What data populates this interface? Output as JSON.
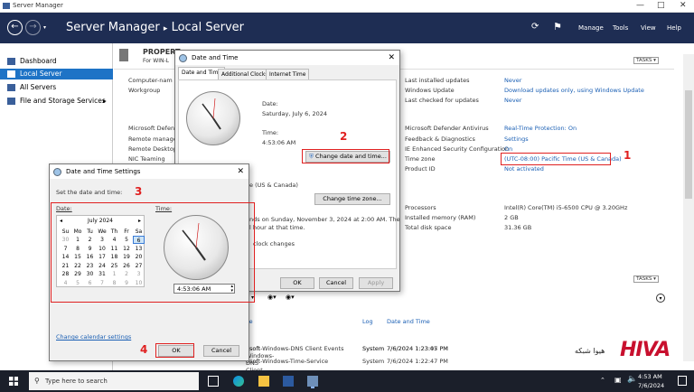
{
  "window": {
    "title": "Server Manager"
  },
  "header": {
    "crumb_root": "Server Manager",
    "crumb_sep": "▸",
    "crumb_page": "Local Server",
    "menu": [
      "Manage",
      "Tools",
      "View",
      "Help"
    ],
    "flag_icon": "⚑"
  },
  "sidebar": {
    "items": [
      {
        "label": "Dashboard"
      },
      {
        "label": "Local Server"
      },
      {
        "label": "All Servers"
      },
      {
        "label": "File and Storage Services",
        "chevron": "▸"
      }
    ]
  },
  "properties": {
    "heading": "PROPERT",
    "sub": "For WIN-L",
    "left_labels": [
      "Computer-nam",
      "Workgroup",
      "Microsoft Defen",
      "Remote manage",
      "Remote Desktop",
      "NIC Teaming"
    ],
    "tasks": "TASKS",
    "right": [
      {
        "label": "Last installed updates",
        "value": "Never"
      },
      {
        "label": "Windows Update",
        "value": "Download updates only, using Windows Update"
      },
      {
        "label": "Last checked for updates",
        "value": "Never"
      },
      {
        "label": "Microsoft Defender Antivirus",
        "value": "Real-Time Protection: On"
      },
      {
        "label": "Feedback & Diagnostics",
        "value": "Settings"
      },
      {
        "label": "IE Enhanced Security Configuration",
        "value": "On"
      },
      {
        "label": "Time zone",
        "value": "(UTC-08:00) Pacific Time (US & Canada)"
      },
      {
        "label": "Product ID",
        "value": "Not activated"
      },
      {
        "label": "Processors",
        "value": "Intel(R) Core(TM) i5-6500 CPU @ 3.20GHz"
      },
      {
        "label": "Installed memory (RAM)",
        "value": "2 GB"
      },
      {
        "label": "Total disk space",
        "value": "31.36 GB"
      }
    ]
  },
  "events": {
    "tasks": "TASKS",
    "columns": [
      "ce",
      "Log",
      "Date and Time"
    ],
    "rows": [
      {
        "source": "osoft-Windows-DNS Client Events",
        "log": "System",
        "time": "7/6/2024 1:23:45 PM"
      },
      {
        "source": "osoft-Windows-DNS Client Events",
        "log": "System",
        "time": "7/6/2024 1:23:07 PM"
      },
      {
        "source": "osoft-Windows-Time-Service",
        "log": "System",
        "time": "7/6/2024 1:22:47 PM"
      }
    ]
  },
  "dt_dialog": {
    "title": "Date and Time",
    "tabs": [
      "Date and Time",
      "Additional Clocks",
      "Internet Time"
    ],
    "date_label": "Date:",
    "date_value": "Saturday, July 6, 2024",
    "time_label": "Time:",
    "time_value": "4:53:06 AM",
    "change_btn": "Change date and time...",
    "tz_text": "e (US & Canada)",
    "tz_btn": "Change time zone...",
    "dst1": "nds on Sunday, November 3, 2024 at 2:00 AM. The",
    "dst2": "l hour at that time.",
    "dst3": "clock changes",
    "ok": "OK",
    "cancel": "Cancel",
    "apply": "Apply"
  },
  "settings_dialog": {
    "title": "Date and Time Settings",
    "prompt": "Set the date and time:",
    "date_label": "Date:",
    "time_label": "Time:",
    "month": "July 2024",
    "prev": "◂",
    "next": "▸",
    "weekdays": [
      "Su",
      "Mo",
      "Tu",
      "We",
      "Th",
      "Fr",
      "Sa"
    ],
    "weeks": [
      [
        "30",
        "1",
        "2",
        "3",
        "4",
        "5",
        "6"
      ],
      [
        "7",
        "8",
        "9",
        "10",
        "11",
        "12",
        "13"
      ],
      [
        "14",
        "15",
        "16",
        "17",
        "18",
        "19",
        "20"
      ],
      [
        "21",
        "22",
        "23",
        "24",
        "25",
        "26",
        "27"
      ],
      [
        "28",
        "29",
        "30",
        "31",
        "1",
        "2",
        "3"
      ],
      [
        "4",
        "5",
        "6",
        "7",
        "8",
        "9",
        "10"
      ]
    ],
    "time_value": "4:53:06 AM",
    "link": "Change calendar settings",
    "ok": "OK",
    "cancel": "Cancel"
  },
  "annotations": [
    "1",
    "2",
    "3",
    "4"
  ],
  "brand": {
    "logo": "HIVA",
    "text": "هیوا شبکه"
  },
  "taskbar": {
    "search_placeholder": "Type here to search",
    "time": "4:53 AM",
    "date": "7/6/2024"
  },
  "colors": {
    "header": "#1e2d53",
    "accent": "#1e73c6",
    "annotation": "#e02020",
    "brand": "#c8102e"
  }
}
